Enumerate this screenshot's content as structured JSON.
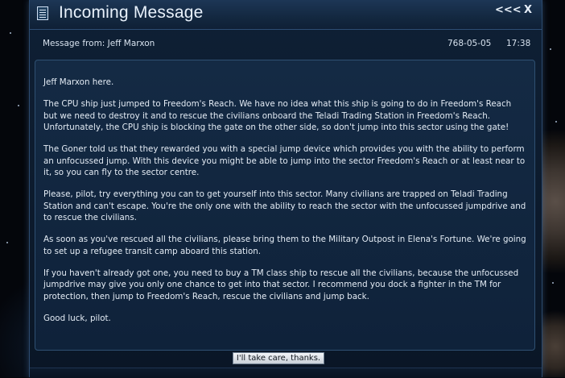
{
  "window": {
    "title": "Incoming Message",
    "controls": {
      "collapse": "<<<",
      "close": "X"
    }
  },
  "header": {
    "from": "Message from: Jeff Marxon",
    "date": "768-05-05",
    "time": "17:38"
  },
  "message": {
    "paragraphs": [
      "Jeff Marxon here.",
      "The CPU ship just jumped to Freedom's Reach. We have no idea what this ship is going to do in Freedom's Reach but we need to destroy it and to rescue the civilians onboard the Teladi Trading Station in Freedom's Reach. Unfortunately, the CPU ship is blocking the gate on the other side, so don't jump into this sector using the gate!",
      "The Goner told us that they rewarded you with a special jump device which provides you with the ability to perform an unfocussed jump. With this device you might be able to jump into the sector Freedom's Reach or at least near to it, so you can fly to the sector centre.",
      "Please, pilot, try everything you can to get yourself into this sector. Many civilians are trapped on Teladi Trading Station and can't escape. You're the only one with the ability to reach the sector with the unfocussed jumpdrive and to rescue the civilians.",
      "As soon as you've rescued all the civilians, please bring them to the Military Outpost in Elena's Fortune. We're going to set up a refugee transit camp aboard this station.",
      "If you haven't already got one, you need to buy a TM class ship to rescue all the civilians, because the unfocussed jumpdrive may give you only one chance to get into that sector. I recommend you dock a fighter in the TM for protection, then jump to Freedom's Reach, rescue the civilians and jump back.",
      "Good luck, pilot."
    ]
  },
  "reply_button": "I'll take care, thanks."
}
